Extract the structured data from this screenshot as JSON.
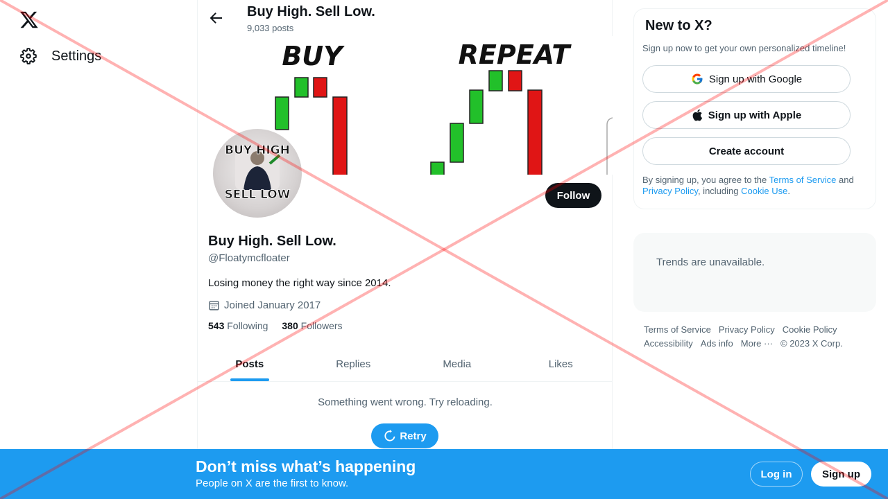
{
  "nav": {
    "settings_label": "Settings"
  },
  "header": {
    "title": "Buy High. Sell Low.",
    "post_count": "9,033 posts"
  },
  "banner": {
    "left_word": "BUY",
    "right_word": "REPEAT"
  },
  "avatar": {
    "line1": "BUY HIGH",
    "line2": "SELL LOW"
  },
  "profile": {
    "follow_label": "Follow",
    "name": "Buy High. Sell Low.",
    "handle": "@Floatymcfloater",
    "bio": "Losing money the right way since 2014.",
    "joined": "Joined January 2017",
    "following_count": "543",
    "following_label": "Following",
    "followers_count": "380",
    "followers_label": "Followers"
  },
  "tabs": [
    "Posts",
    "Replies",
    "Media",
    "Likes"
  ],
  "feed": {
    "error": "Something went wrong. Try reloading.",
    "retry_label": "Retry"
  },
  "signup_panel": {
    "title": "New to X?",
    "subtitle": "Sign up now to get your own personalized timeline!",
    "google_label": "Sign up with Google",
    "apple_label": "Sign up with Apple",
    "create_label": "Create account",
    "legal_prefix": "By signing up, you agree to the ",
    "terms_link": "Terms of Service",
    "legal_and": " and ",
    "privacy_link": "Privacy Policy",
    "legal_including": ", including ",
    "cookie_link": "Cookie Use",
    "legal_end": "."
  },
  "trends": {
    "text": "Trends are unavailable."
  },
  "footer": {
    "terms": "Terms of Service",
    "privacy": "Privacy Policy",
    "cookie": "Cookie Policy",
    "accessibility": "Accessibility",
    "ads": "Ads info",
    "more": "More ···",
    "copyright": "© 2023 X Corp."
  },
  "bottom_bar": {
    "title": "Don’t miss what’s happening",
    "subtitle": "People on X are the first to know.",
    "login_label": "Log in",
    "signup_label": "Sign up"
  },
  "colors": {
    "accent": "#1d9bf0",
    "text": "#0f1419",
    "muted": "#536471",
    "candle_green": "#22c02a",
    "candle_red": "#e01515",
    "overlay_red": "#ff0000"
  }
}
